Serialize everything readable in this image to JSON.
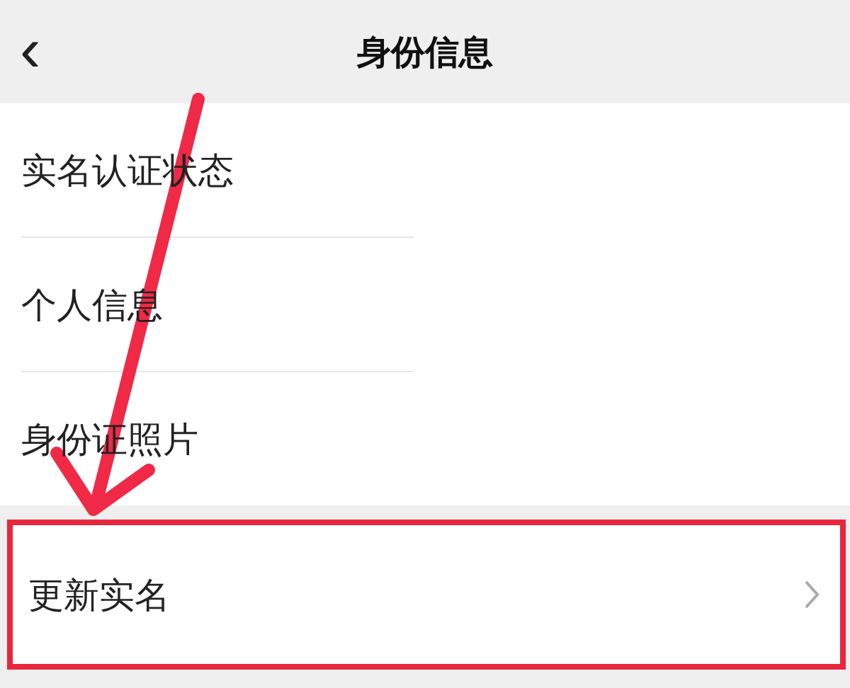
{
  "header": {
    "title": "身份信息",
    "back": "‹"
  },
  "items": [
    {
      "label": "实名认证状态"
    },
    {
      "label": "个人信息"
    },
    {
      "label": "身份证照片"
    }
  ],
  "action": {
    "label": "更新实名",
    "highlighted": true
  }
}
